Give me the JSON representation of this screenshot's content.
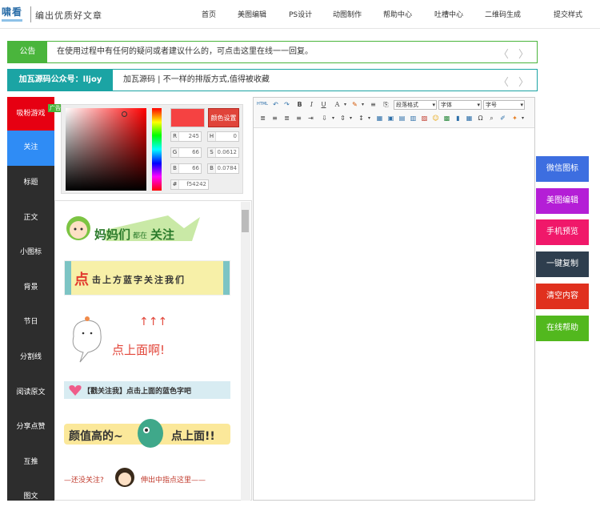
{
  "header": {
    "logo_text": "啸看",
    "slogan": "编出优质好文章",
    "nav": [
      "首页",
      "美图编辑",
      "PS设计",
      "动图制作",
      "帮助中心",
      "吐槽中心",
      "二维码生成",
      "提交样式"
    ]
  },
  "notice": {
    "tag": "公告",
    "text": "在使用过程中有任何的疑问或者建议什么的，可点击这里在线一一回复。",
    "arrows": "〈 〉"
  },
  "account": {
    "tag": "加瓦源码公众号：lljoy",
    "text": "加瓦源码 | 不一样的排版方式,值得被收藏",
    "arrows": "〈 〉"
  },
  "sidebar": {
    "items": [
      {
        "label": "吸粉游戏"
      },
      {
        "label": "关注"
      },
      {
        "label": "标题"
      },
      {
        "label": "正文"
      },
      {
        "label": "小图标"
      },
      {
        "label": "背景"
      },
      {
        "label": "节日"
      },
      {
        "label": "分割线"
      },
      {
        "label": "阅读原文"
      },
      {
        "label": "分享点赞"
      },
      {
        "label": "互推"
      },
      {
        "label": "图文"
      }
    ],
    "ad_badge": "广告"
  },
  "color_picker": {
    "button_label": "颜色设置",
    "swatch_color": "#f54242",
    "R": "245",
    "G": "66",
    "B": "66",
    "H": "0",
    "S": "0.0612",
    "Bv": "0.0784",
    "hex_label": "#",
    "hex": "f54242"
  },
  "stickers": [
    {
      "text1": "妈妈们",
      "text2": "都在",
      "text3": "关注"
    },
    {
      "text1": "点",
      "text2": "击上方蓝字关注我们"
    },
    {
      "arrows": "↑↑↑",
      "text": "点上面啊!"
    },
    {
      "text": "【戳关注我】点击上面的蓝色字吧"
    },
    {
      "text1": "颜值高的~",
      "text2": "点上面!!"
    },
    {
      "text1": "—还没关注?",
      "text2": "伸出中指点这里——"
    }
  ],
  "editor": {
    "html_label": "HTML",
    "paragraph_select": "段落格式",
    "font_select": "字体",
    "size_select": "字号"
  },
  "actions": [
    {
      "label": "微信图标",
      "color": "#3d6ee0"
    },
    {
      "label": "美图编辑",
      "color": "#b41ed6"
    },
    {
      "label": "手机预览",
      "color": "#f0186a"
    },
    {
      "label": "一键复制",
      "color": "#2e3e4e"
    },
    {
      "label": "清空内容",
      "color": "#e0301e"
    },
    {
      "label": "在线帮助",
      "color": "#52b81e"
    }
  ],
  "colors": {
    "notice_green": "#4ab53c",
    "account_teal": "#1ba4a4",
    "sidebar_dark": "#2d2d2d",
    "sidebar_red": "#e60012",
    "sidebar_blue": "#2f8cf5"
  }
}
